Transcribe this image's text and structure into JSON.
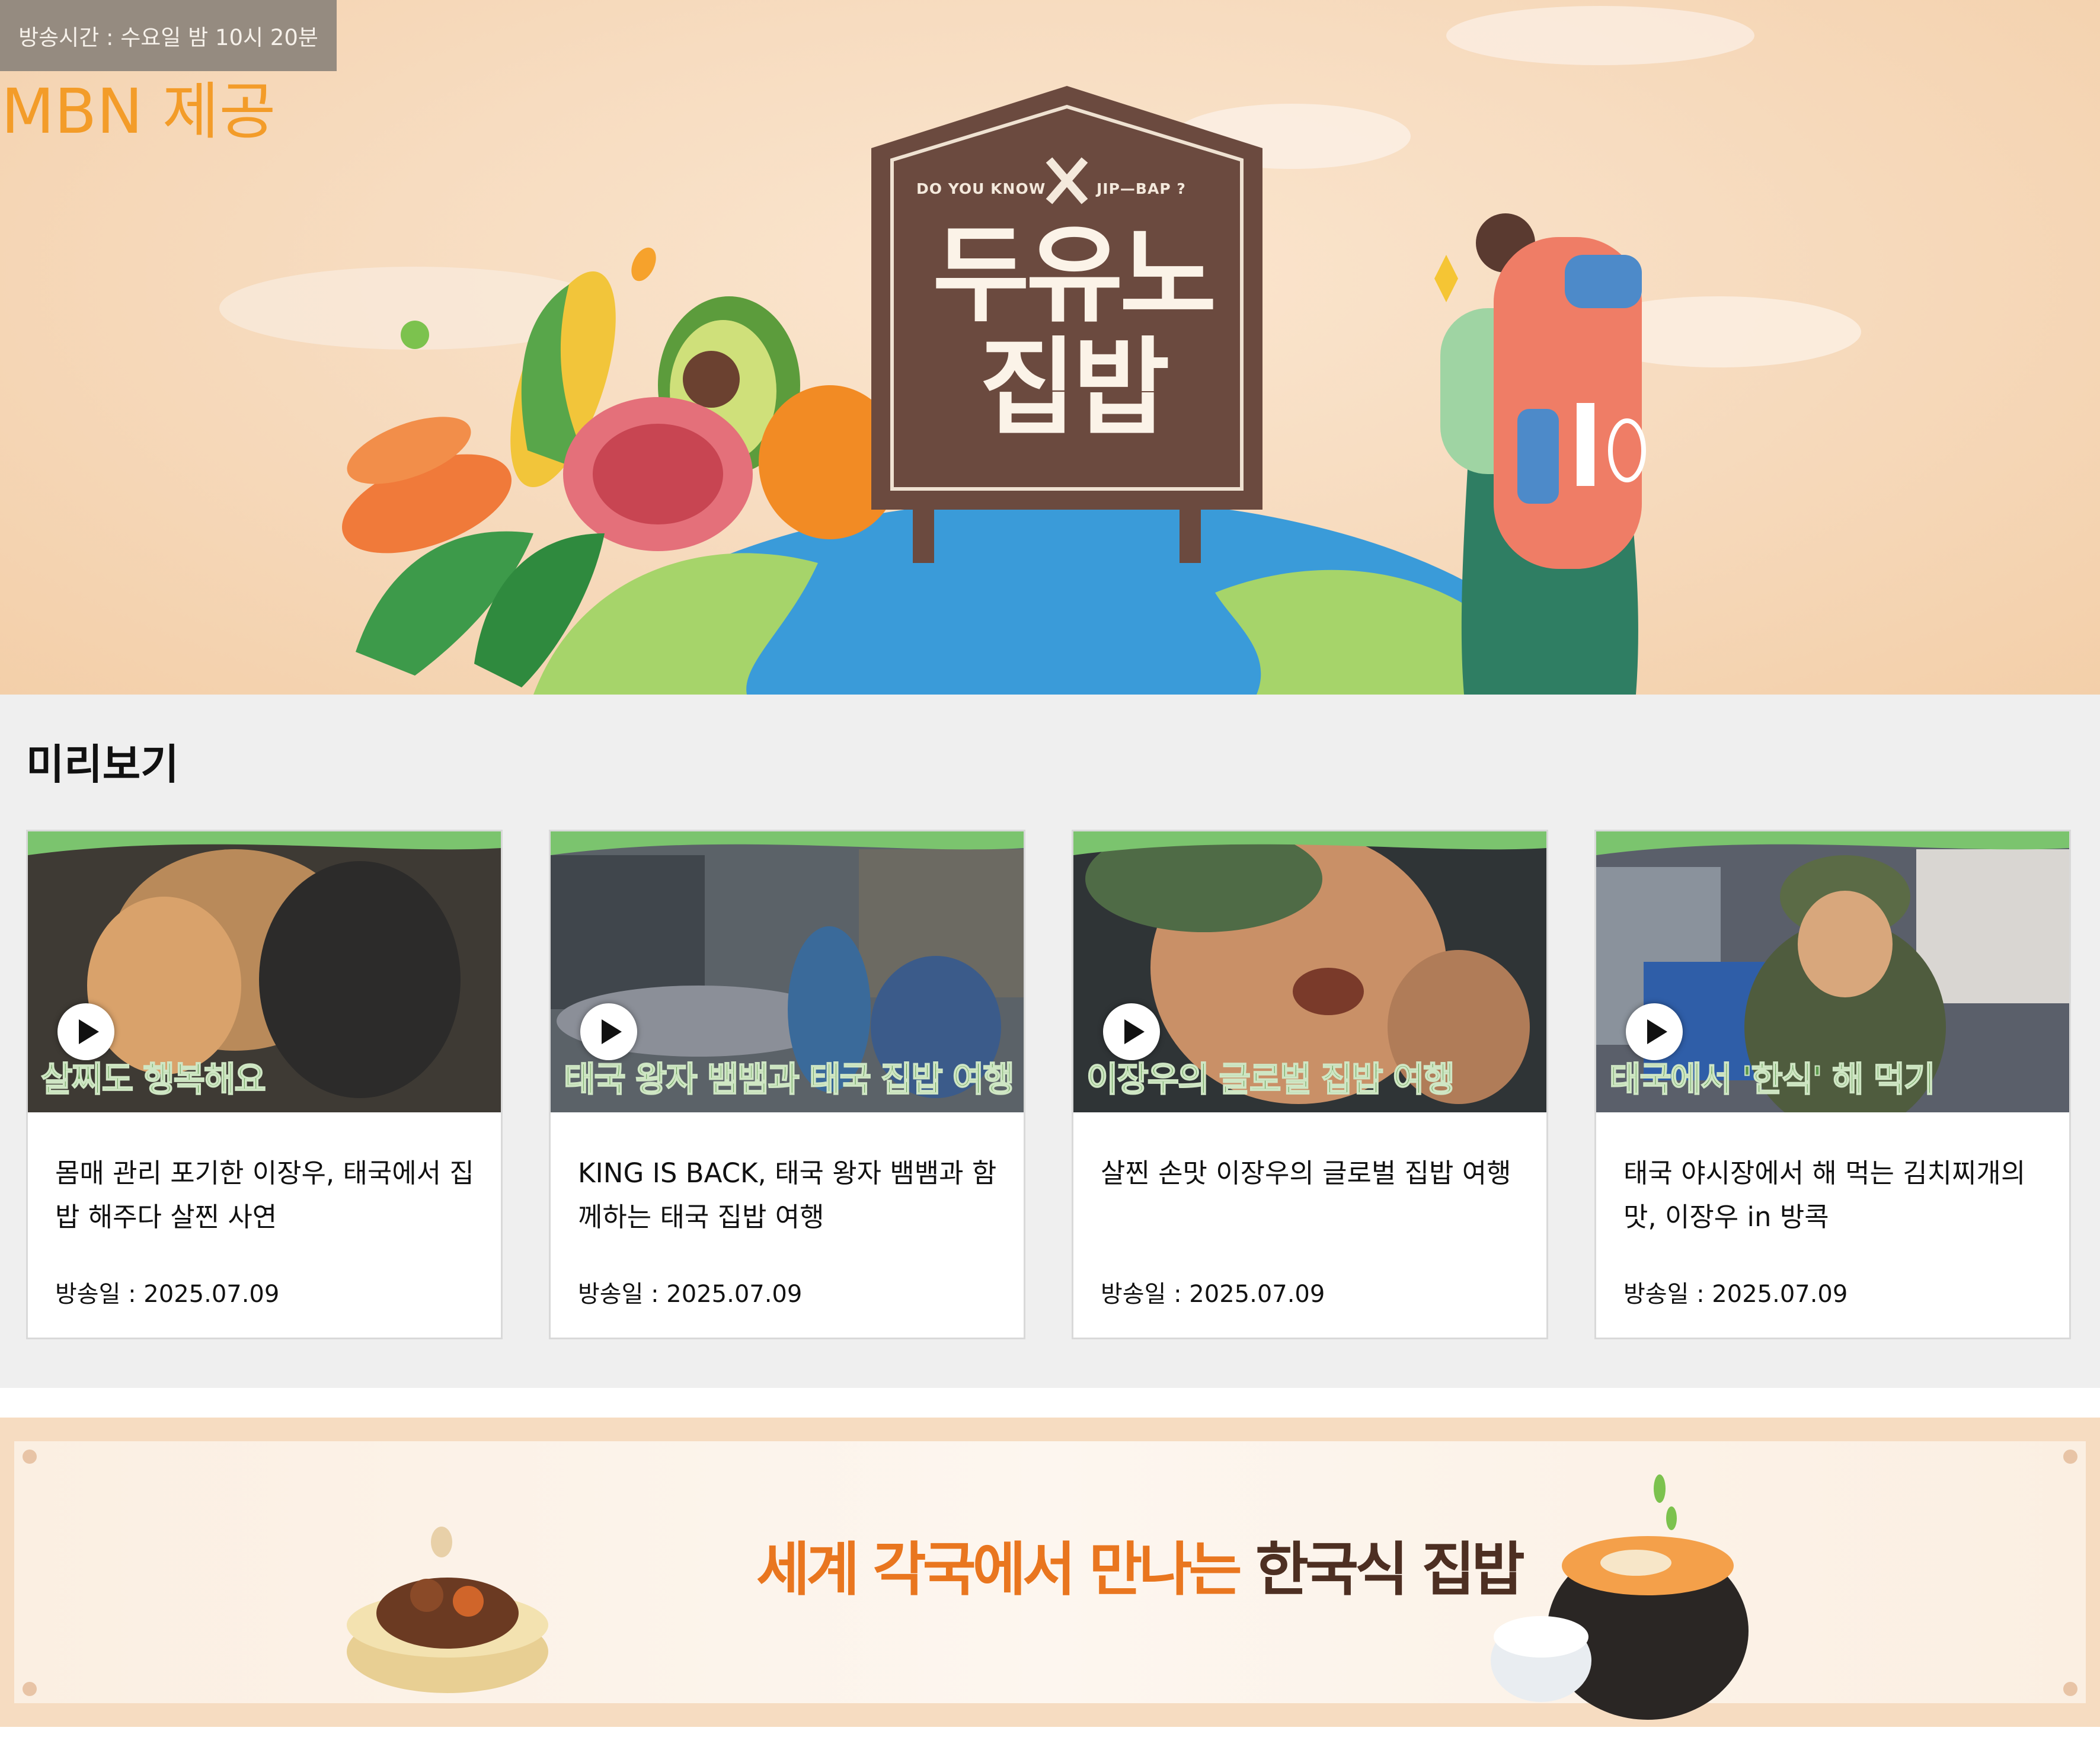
{
  "hero": {
    "airtime": "방송시간 : 수요일 밤 10시 20분",
    "provider": "MBN 제공",
    "sign_left": "DO YOU KNOW",
    "sign_right": "JIP—BAP ?",
    "logo_title": "두유노 집밥",
    "colors": {
      "sign": "#6b4a3f",
      "globe": "#3a9bd9",
      "land": "#a6d46a",
      "provider": "#f39c29"
    }
  },
  "preview": {
    "title": "미리보기",
    "cards": [
      {
        "caption": "살찌도 행복해요",
        "title": "몸매 관리 포기한 이장우, 태국에서 집밥 해주다 살찐 사연",
        "date": "방송일 : 2025.07.09"
      },
      {
        "caption": "태국 왕자 뱀뱀과 태국 집밥 여행",
        "title": "KING IS BACK, 태국 왕자 뱀뱀과 함께하는 태국 집밥 여행",
        "date": "방송일 : 2025.07.09"
      },
      {
        "caption": "이장우의 글로벌 집밥 여행",
        "title": "살찐 손맛 이장우의 글로벌 집밥 여행",
        "date": "방송일 : 2025.07.09"
      },
      {
        "caption": "태국에서 '한식' 해 먹기",
        "title": "태국 야시장에서 해 먹는 김치찌개의 맛, 이장우 in 방콕",
        "date": "방송일 : 2025.07.09"
      }
    ]
  },
  "banner": {
    "text_highlight": "세계 각국",
    "text_rest": "에서 만나는 ",
    "text_dark": "한국식 집밥",
    "colors": {
      "highlight": "#e9761f",
      "dark": "#4d2f22"
    }
  }
}
